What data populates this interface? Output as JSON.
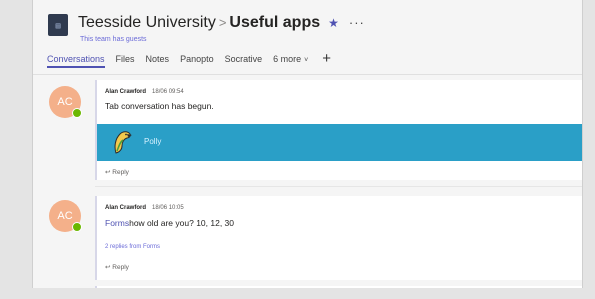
{
  "header": {
    "team_name": "Teesside University",
    "separator": ">",
    "channel_name": "Useful apps",
    "star_icon": "star-icon",
    "more_label": "···",
    "subtitle": "This team has guests"
  },
  "tabs": [
    {
      "label": "Conversations",
      "active": true
    },
    {
      "label": "Files"
    },
    {
      "label": "Notes"
    },
    {
      "label": "Panopto"
    },
    {
      "label": "Socrative"
    },
    {
      "label": "6 more"
    },
    {
      "label": "+"
    }
  ],
  "messages": [
    {
      "avatar": "AC",
      "author": "Alan Crawford",
      "time": "18/06 09:54",
      "text": "Tab conversation has begun.",
      "banner_label": "Polly",
      "reply_label": "Reply"
    },
    {
      "avatar": "AC",
      "author": "Alan Crawford",
      "time": "18/06 10:05",
      "link_text": "Forms",
      "text": "how old are you? 10, 12, 30",
      "replies_label": "2 replies from Forms",
      "reply_label": "Reply"
    }
  ],
  "colors": {
    "accent": "#4f52b2",
    "banner": "#2a9fc7",
    "avatar": "#f4b08a",
    "presence": "#6bb700"
  }
}
